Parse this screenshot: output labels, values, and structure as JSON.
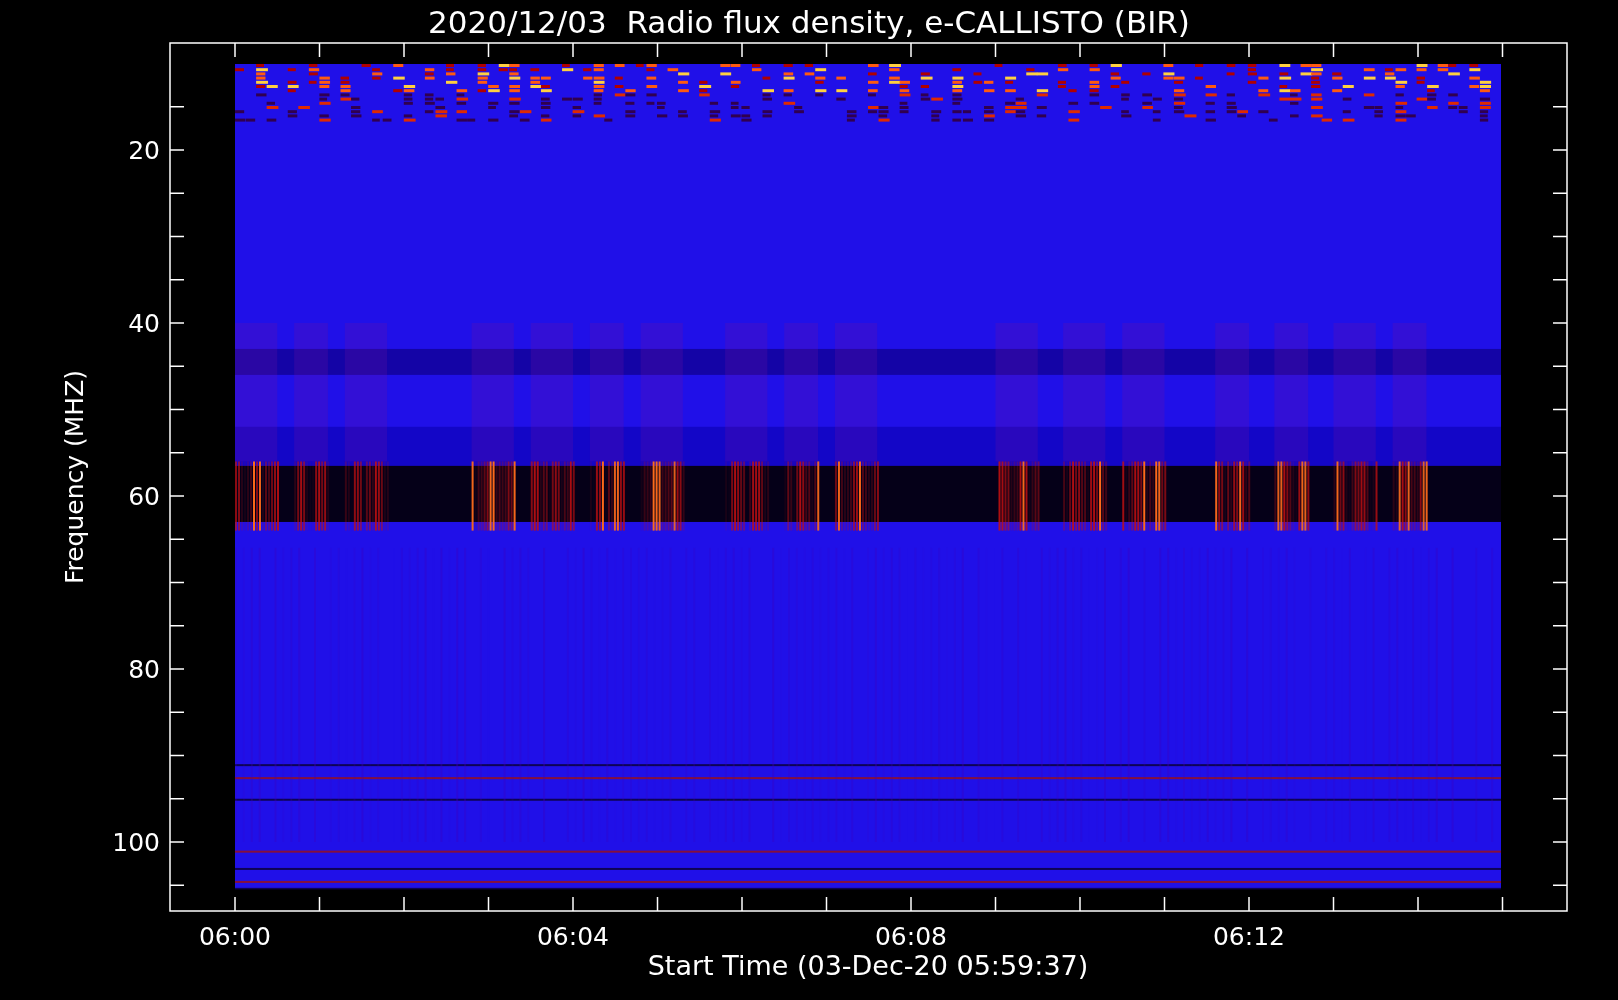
{
  "plot": {
    "title": "2020/12/03  Radio flux density, e-CALLISTO (BIR)",
    "xlabel": "Start Time (03-Dec-20 05:59:37)",
    "ylabel": "Frequency (MHZ)",
    "y_tick_labels": [
      "20",
      "40",
      "60",
      "80",
      "100"
    ],
    "x_tick_labels": [
      "06:00",
      "06:04",
      "06:08",
      "06:12"
    ]
  }
}
